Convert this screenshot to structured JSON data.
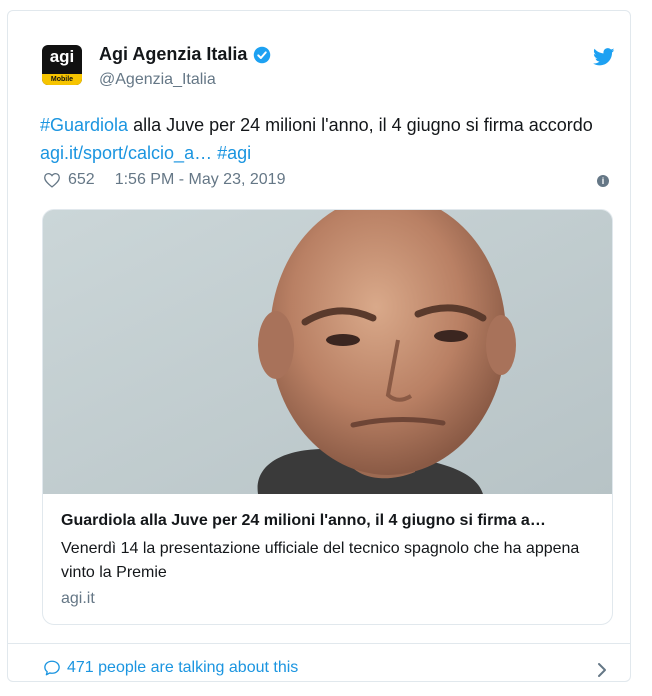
{
  "account": {
    "name": "Agi Agenzia Italia",
    "handle": "@Agenzia_Italia",
    "avatar_text": "agi",
    "avatar_strip": "Mobile"
  },
  "tweet": {
    "hashtag1": "#Guardiola",
    "text_part1": " alla Juve per 24 milioni l'anno, il 4 giugno si firma accordo ",
    "link": "agi.it/sport/calcio_a…",
    "text_space": " ",
    "hashtag2": "#agi"
  },
  "meta": {
    "likes": "652",
    "timestamp": "1:56 PM - May 23, 2019",
    "info_glyph": "i"
  },
  "preview": {
    "title": "Guardiola alla Juve per 24 milioni l'anno, il 4 giugno si firma a…",
    "description": "Venerdì 14 la presentazione ufficiale del tecnico spagnolo che ha appena vinto la Premie",
    "domain": "agi.it"
  },
  "footer": {
    "talking": "471 people are talking about this"
  },
  "colors": {
    "link": "#1b95e0",
    "muted": "#657786",
    "border": "#e1e8ed",
    "twitter_blue": "#1da1f2"
  },
  "icons": [
    "verified-badge-icon",
    "twitter-bird-icon",
    "heart-icon",
    "info-icon",
    "comment-bubble-icon",
    "chevron-right-icon"
  ]
}
